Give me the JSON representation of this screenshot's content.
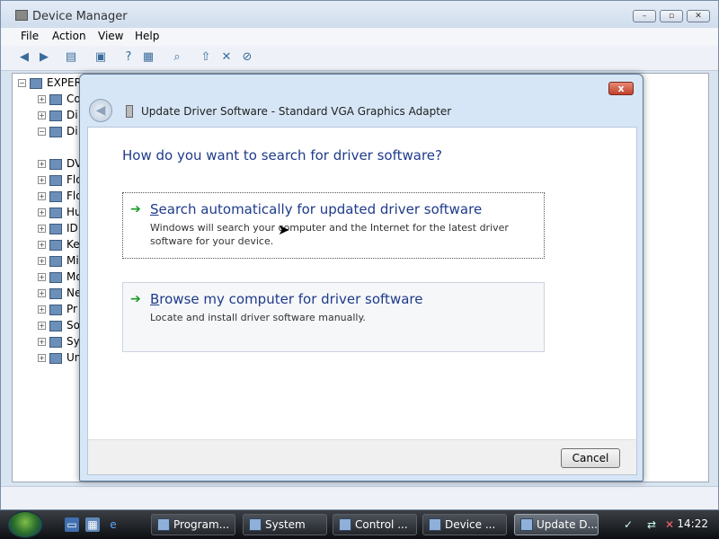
{
  "device_manager": {
    "title": "Device Manager",
    "menu": [
      "File",
      "Action",
      "View",
      "Help"
    ],
    "tree_root": "EXPER",
    "tree_items": [
      "Co",
      "Di",
      "Di",
      "DV",
      "Flo",
      "Flo",
      "Hu",
      "ID",
      "Ke",
      "Mi",
      "Mo",
      "Ne",
      "Pr",
      "So",
      "Sy",
      "Un"
    ]
  },
  "dialog": {
    "title": "Update Driver Software - Standard VGA Graphics Adapter",
    "close_label": "x",
    "question": "How do you want to search for driver software?",
    "option1": {
      "title_accel": "S",
      "title_rest": "earch automatically for updated driver software",
      "desc": "Windows will search your computer and the Internet for the latest driver software for your device."
    },
    "option2": {
      "title_accel": "B",
      "title_rest": "rowse my computer for driver software",
      "desc": "Locate and install driver software manually."
    },
    "cancel_label": "Cancel"
  },
  "taskbar": {
    "tasks": [
      "Program...",
      "System",
      "Control ...",
      "Device ...",
      "Update D..."
    ],
    "clock": "14:22"
  },
  "icons": [
    "back-arrow-icon",
    "forward-arrow-icon",
    "help-icon",
    "scan-icon",
    "update-driver-icon",
    "uninstall-icon",
    "disable-icon"
  ],
  "colors": {
    "accent_blue": "#1e3b8a",
    "arrow_green": "#1b9a2a",
    "close_red": "#c0412a"
  }
}
